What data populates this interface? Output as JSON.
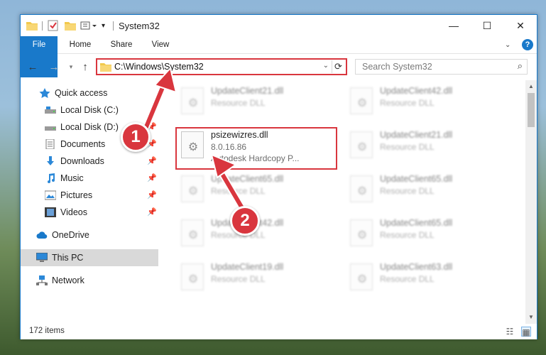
{
  "window": {
    "title": "System32",
    "controls": {
      "minimize": "—",
      "maximize": "☐",
      "close": "✕"
    }
  },
  "ribbon": {
    "tabs": [
      "File",
      "Home",
      "Share",
      "View"
    ],
    "help": "?"
  },
  "nav": {
    "address": "C:\\Windows\\System32",
    "search_placeholder": "Search System32"
  },
  "sidebar": {
    "items": [
      {
        "label": "Quick access",
        "icon": "star-icon",
        "pinned": false
      },
      {
        "label": "Local Disk (C:)",
        "icon": "drive-icon",
        "pinned": false
      },
      {
        "label": "Local Disk (D:)",
        "icon": "drive-icon",
        "pinned": true
      },
      {
        "label": "Documents",
        "icon": "documents-icon",
        "pinned": true
      },
      {
        "label": "Downloads",
        "icon": "download-icon",
        "pinned": true
      },
      {
        "label": "Music",
        "icon": "music-icon",
        "pinned": true
      },
      {
        "label": "Pictures",
        "icon": "pictures-icon",
        "pinned": true
      },
      {
        "label": "Videos",
        "icon": "videos-icon",
        "pinned": true
      },
      {
        "label": "OneDrive",
        "icon": "cloud-icon",
        "pinned": false
      },
      {
        "label": "This PC",
        "icon": "pc-icon",
        "pinned": false,
        "selected": true
      },
      {
        "label": "Network",
        "icon": "network-icon",
        "pinned": false
      }
    ]
  },
  "files": {
    "highlighted": {
      "name": "psizewizres.dll",
      "version": "8.0.16.86",
      "description": "Autodesk Hardcopy P..."
    },
    "left_column": [
      {
        "name": "UpdateClient21.dll",
        "type": "Resource DLL"
      },
      {
        "name": "UpdateClient65.dll",
        "type": "Resource DLL"
      },
      {
        "name": "UpdateClient42.dll",
        "type": "Resource DLL"
      },
      {
        "name": "UpdateClient19.dll",
        "type": "Resource DLL"
      }
    ],
    "right_column": [
      {
        "name": "UpdateClient42.dll",
        "type": "Resource DLL"
      },
      {
        "name": "UpdateClient21.dll",
        "type": "Resource DLL"
      },
      {
        "name": "UpdateClient65.dll",
        "type": "Resource DLL"
      },
      {
        "name": "UpdateClient65.dll",
        "type": "Resource DLL"
      },
      {
        "name": "UpdateClient63.dll",
        "type": "Resource DLL"
      }
    ]
  },
  "status": {
    "item_count": "172 items"
  },
  "callouts": {
    "step1": "1",
    "step2": "2"
  },
  "colors": {
    "accent": "#1979ca",
    "highlight": "#d9363e"
  }
}
